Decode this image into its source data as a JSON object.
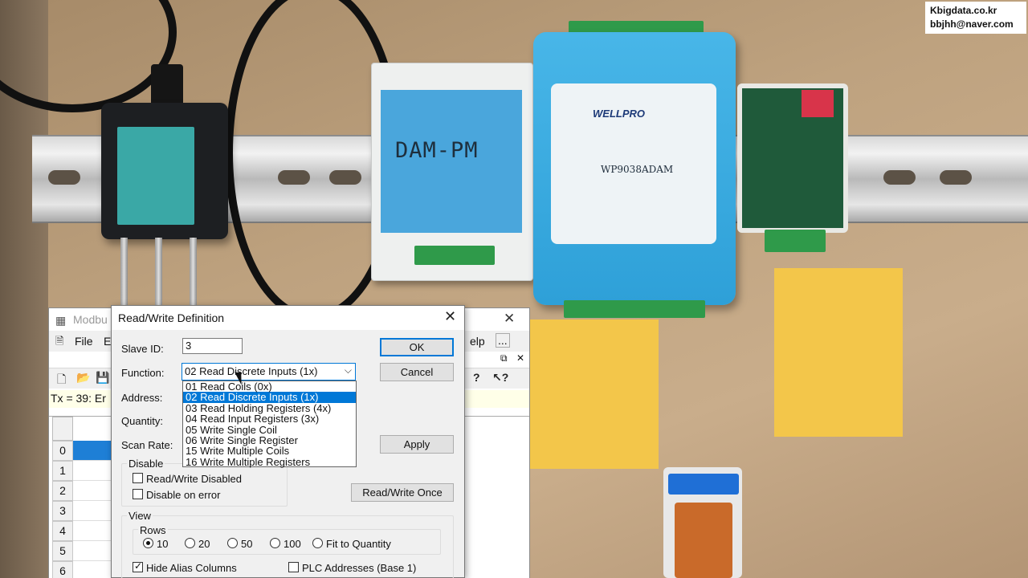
{
  "watermark": {
    "line1": "Kbigdata.co.kr",
    "line2": "bbjhh@naver.com"
  },
  "hardware": {
    "module1_title": "DAM-PM",
    "module2_brand": "WELLPRO",
    "module2_model": "WP9038ADAM"
  },
  "main_window": {
    "title": "Modbu",
    "menu": {
      "file": "File",
      "edit": "E",
      "help": "elp",
      "dots": "..."
    },
    "status": "Tx = 39: Er",
    "rows": [
      "0",
      "1",
      "2",
      "3",
      "4",
      "5",
      "6"
    ]
  },
  "dialog": {
    "title": "Read/Write Definition",
    "slave_id_label": "Slave ID:",
    "slave_id_value": "3",
    "function_label": "Function:",
    "function_selected": "02 Read Discrete Inputs (1x)",
    "function_options": [
      "01 Read Coils (0x)",
      "02 Read Discrete Inputs (1x)",
      "03 Read Holding Registers (4x)",
      "04 Read Input Registers (3x)",
      "05 Write Single Coil",
      "06 Write Single Register",
      "15 Write Multiple Coils",
      "16 Write Multiple Registers"
    ],
    "highlighted_option_index": 1,
    "address_label": "Address:",
    "quantity_label": "Quantity:",
    "scan_rate_label": "Scan Rate:",
    "ok": "OK",
    "cancel": "Cancel",
    "apply": "Apply",
    "rw_once": "Read/Write Once",
    "disable_group": {
      "title": "Disable",
      "rw_disabled": "Read/Write Disabled",
      "rw_disabled_checked": false,
      "disable_on_error": "Disable on error",
      "disable_on_error_checked": false
    },
    "view_group": {
      "title": "View",
      "rows_title": "Rows",
      "options": [
        "10",
        "20",
        "50",
        "100",
        "Fit to Quantity"
      ],
      "selected": "10",
      "hide_alias": "Hide Alias Columns",
      "hide_alias_checked": true,
      "plc_addresses": "PLC Addresses (Base 1)",
      "plc_addresses_checked": false
    }
  }
}
